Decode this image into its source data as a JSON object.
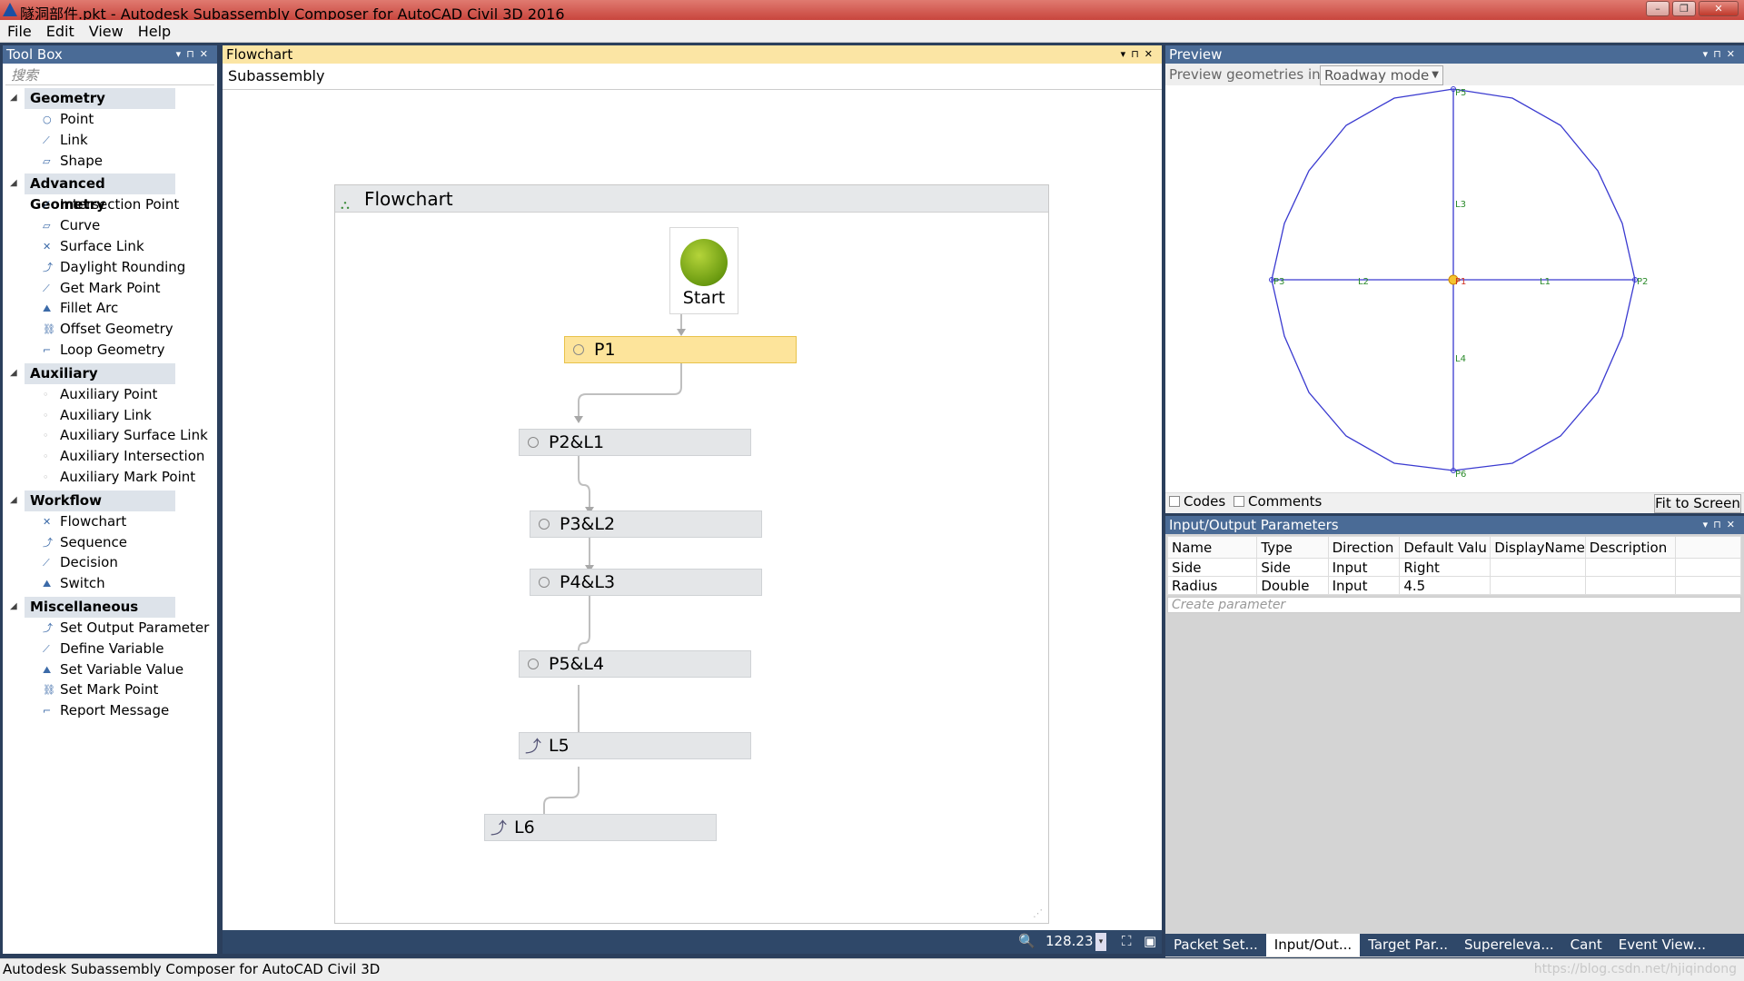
{
  "window": {
    "title": "隧洞部件.pkt - Autodesk Subassembly Composer for AutoCAD Civil 3D 2016",
    "controls": [
      "–",
      "❐",
      "✕"
    ]
  },
  "menu": [
    "File",
    "Edit",
    "View",
    "Help"
  ],
  "toolbox": {
    "title": "Tool Box",
    "search_placeholder": "搜索",
    "categories": [
      {
        "label": "Geometry",
        "items": [
          "Point",
          "Link",
          "Shape"
        ]
      },
      {
        "label": "Advanced Geometry",
        "items": [
          "Intersection Point",
          "Curve",
          "Surface Link",
          "Daylight Rounding",
          "Get Mark Point",
          "Fillet Arc",
          "Offset Geometry",
          "Loop Geometry"
        ]
      },
      {
        "label": "Auxiliary",
        "items": [
          "Auxiliary Point",
          "Auxiliary Link",
          "Auxiliary Surface Link",
          "Auxiliary Intersection",
          "Auxiliary Mark Point"
        ]
      },
      {
        "label": "Workflow",
        "items": [
          "Flowchart",
          "Sequence",
          "Decision",
          "Switch"
        ]
      },
      {
        "label": "Miscellaneous",
        "items": [
          "Set Output Parameter",
          "Define Variable",
          "Set Variable Value",
          "Set Mark Point",
          "Report Message"
        ]
      }
    ]
  },
  "document": {
    "tab_title": "Flowchart",
    "subtitle": "Subassembly",
    "flowchart_title": "Flowchart",
    "start_label": "Start",
    "nodes": [
      "P1",
      "P2&L1",
      "P3&L2",
      "P4&L3",
      "P5&L4",
      "L5",
      "L6"
    ],
    "zoom": "128.23"
  },
  "preview": {
    "title": "Preview",
    "label": "Preview geometries in",
    "mode": "Roadway mode",
    "codes_label": "Codes",
    "comments_label": "Comments",
    "fit_button": "Fit to Screen",
    "geometry_labels": {
      "p1": "P1",
      "p2": "P2",
      "p3": "P3",
      "p4": "P5",
      "p5": "P6",
      "l1": "L1",
      "l2": "L2",
      "l3": "L3",
      "l4": "L4"
    }
  },
  "io_params": {
    "title": "Input/Output Parameters",
    "columns": [
      "Name",
      "Type",
      "Direction",
      "Default Valu",
      "DisplayName",
      "Description"
    ],
    "rows": [
      [
        "Side",
        "Side",
        "Input",
        "Right",
        "",
        ""
      ],
      [
        "Radius",
        "Double",
        "Input",
        "4.5",
        "",
        ""
      ]
    ],
    "create_placeholder": "Create parameter"
  },
  "bottom_tabs": [
    "Packet Set...",
    "Input/Out...",
    "Target Par...",
    "Supereleva...",
    "Cant",
    "Event View..."
  ],
  "status_text": "Autodesk Subassembly Composer for AutoCAD Civil 3D",
  "watermark": "https://blog.csdn.net/hjiqindong",
  "colors": {
    "active_header": "#fbe5a4",
    "panel_header": "#4a6b96",
    "selected_node": "#fde49b",
    "preview_lines": "#3a3ad0"
  }
}
